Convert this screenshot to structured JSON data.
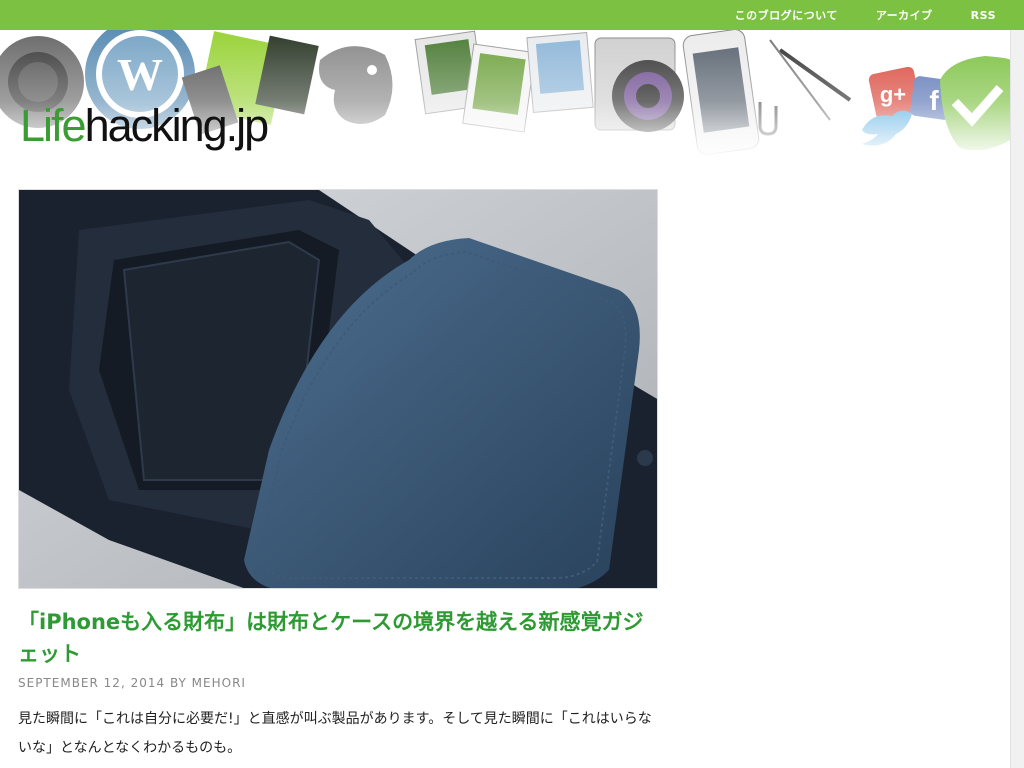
{
  "nav": {
    "items": [
      "このブログについて",
      "アーカイブ",
      "RSS"
    ]
  },
  "site": {
    "logo_life": "Life",
    "logo_rest": "hacking.jp"
  },
  "post": {
    "title": "「iPhoneも入る財布」は財布とケースの境界を越える新感覚ガジェット",
    "date": "SEPTEMBER 12, 2014",
    "by": "BY",
    "author": "MEHORI",
    "excerpt": "見た瞬間に「これは自分に必要だ!」と直感が叫ぶ製品があります。そして見た瞬間に「これはいらないな」となんとなくわかるものも。"
  },
  "colors": {
    "accent": "#7cc142",
    "title_green": "#2e9a33",
    "logo_green": "#3a9d33"
  },
  "icons": [
    "wordpress-icon",
    "evernote-icon",
    "camera-icon",
    "google-plus-icon",
    "facebook-icon",
    "twitter-icon",
    "check-icon"
  ]
}
